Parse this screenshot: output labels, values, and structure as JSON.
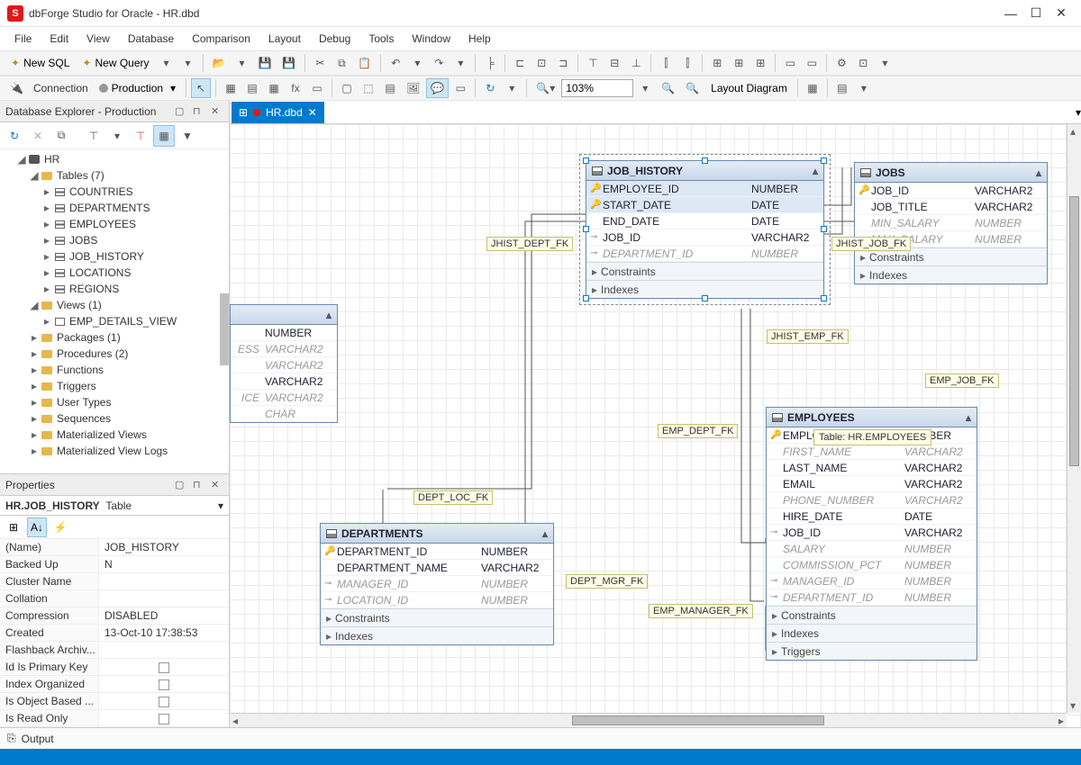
{
  "window": {
    "title": "dbForge Studio for Oracle - HR.dbd"
  },
  "menu": [
    "File",
    "Edit",
    "View",
    "Database",
    "Comparison",
    "Layout",
    "Debug",
    "Tools",
    "Window",
    "Help"
  ],
  "toolbar1": {
    "newsql": "New SQL",
    "newquery": "New Query"
  },
  "toolbar2": {
    "connection_label": "Connection",
    "connection_value": "Production",
    "zoom": "103%",
    "layout_btn": "Layout Diagram"
  },
  "tab": {
    "label": "HR.dbd"
  },
  "explorer": {
    "title": "Database Explorer - Production",
    "root": "HR",
    "tables_label": "Tables (7)",
    "tables": [
      "COUNTRIES",
      "DEPARTMENTS",
      "EMPLOYEES",
      "JOBS",
      "JOB_HISTORY",
      "LOCATIONS",
      "REGIONS"
    ],
    "views_label": "Views (1)",
    "views": [
      "EMP_DETAILS_VIEW"
    ],
    "folders": [
      "Packages (1)",
      "Procedures (2)",
      "Functions",
      "Triggers",
      "User Types",
      "Sequences",
      "Materialized Views",
      "Materialized View Logs"
    ]
  },
  "properties": {
    "title": "Properties",
    "subject": "HR.JOB_HISTORY",
    "subject_type": "Table",
    "rows": [
      {
        "name": "(Name)",
        "value": "JOB_HISTORY"
      },
      {
        "name": "Backed Up",
        "value": "N"
      },
      {
        "name": "Cluster Name",
        "value": ""
      },
      {
        "name": "Collation",
        "value": ""
      },
      {
        "name": "Compression",
        "value": "DISABLED"
      },
      {
        "name": "Created",
        "value": "13-Oct-10 17:38:53"
      },
      {
        "name": "Flashback Archiv...",
        "value": ""
      },
      {
        "name": "Id Is Primary Key",
        "value": "",
        "checkbox": true
      },
      {
        "name": "Index Organized",
        "value": "",
        "checkbox": true
      },
      {
        "name": "Is Object Based ...",
        "value": "",
        "checkbox": true
      },
      {
        "name": "Is Read Only",
        "value": "",
        "checkbox": true
      }
    ]
  },
  "entities": {
    "job_history": {
      "name": "JOB_HISTORY",
      "cols": [
        {
          "key": "pk",
          "name": "EMPLOYEE_ID",
          "type": "NUMBER"
        },
        {
          "key": "pk",
          "name": "START_DATE",
          "type": "DATE"
        },
        {
          "key": "",
          "name": "END_DATE",
          "type": "DATE"
        },
        {
          "key": "fk",
          "name": "JOB_ID",
          "type": "VARCHAR2"
        },
        {
          "key": "fk",
          "name": "DEPARTMENT_ID",
          "type": "NUMBER",
          "null": true
        }
      ],
      "sections": [
        "Constraints",
        "Indexes"
      ]
    },
    "jobs": {
      "name": "JOBS",
      "cols": [
        {
          "key": "pk",
          "name": "JOB_ID",
          "type": "VARCHAR2"
        },
        {
          "key": "",
          "name": "JOB_TITLE",
          "type": "VARCHAR2"
        },
        {
          "key": "",
          "name": "MIN_SALARY",
          "type": "NUMBER",
          "null": true
        },
        {
          "key": "",
          "name": "MAX_SALARY",
          "type": "NUMBER",
          "null": true
        }
      ],
      "sections": [
        "Constraints",
        "Indexes"
      ]
    },
    "departments": {
      "name": "DEPARTMENTS",
      "cols": [
        {
          "key": "pk",
          "name": "DEPARTMENT_ID",
          "type": "NUMBER"
        },
        {
          "key": "",
          "name": "DEPARTMENT_NAME",
          "type": "VARCHAR2"
        },
        {
          "key": "fk",
          "name": "MANAGER_ID",
          "type": "NUMBER",
          "null": true
        },
        {
          "key": "fk",
          "name": "LOCATION_ID",
          "type": "NUMBER",
          "null": true
        }
      ],
      "sections": [
        "Constraints",
        "Indexes"
      ]
    },
    "employees": {
      "name": "EMPLOYEES",
      "cols": [
        {
          "key": "pk",
          "name": "EMPLOYEE_ID",
          "type": "NUMBER"
        },
        {
          "key": "",
          "name": "FIRST_NAME",
          "type": "VARCHAR2",
          "null": true
        },
        {
          "key": "",
          "name": "LAST_NAME",
          "type": "VARCHAR2"
        },
        {
          "key": "",
          "name": "EMAIL",
          "type": "VARCHAR2"
        },
        {
          "key": "",
          "name": "PHONE_NUMBER",
          "type": "VARCHAR2",
          "null": true
        },
        {
          "key": "",
          "name": "HIRE_DATE",
          "type": "DATE"
        },
        {
          "key": "fk",
          "name": "JOB_ID",
          "type": "VARCHAR2"
        },
        {
          "key": "",
          "name": "SALARY",
          "type": "NUMBER",
          "null": true
        },
        {
          "key": "",
          "name": "COMMISSION_PCT",
          "type": "NUMBER",
          "null": true
        },
        {
          "key": "fk",
          "name": "MANAGER_ID",
          "type": "NUMBER",
          "null": true
        },
        {
          "key": "fk",
          "name": "DEPARTMENT_ID",
          "type": "NUMBER",
          "null": true
        }
      ],
      "sections": [
        "Constraints",
        "Indexes",
        "Triggers"
      ]
    },
    "partial": {
      "cols": [
        {
          "name": "",
          "type": "NUMBER"
        },
        {
          "name": "ESS",
          "type": "VARCHAR2",
          "null": true
        },
        {
          "name": "",
          "type": "VARCHAR2",
          "null": true
        },
        {
          "name": "",
          "type": "VARCHAR2"
        },
        {
          "name": "ICE",
          "type": "VARCHAR2",
          "null": true
        },
        {
          "name": "",
          "type": "CHAR",
          "null": true
        }
      ]
    }
  },
  "fk_labels": {
    "jhist_dept": "JHIST_DEPT_FK",
    "jhist_job": "JHIST_JOB_FK",
    "jhist_emp": "JHIST_EMP_FK",
    "emp_job": "EMP_JOB_FK",
    "emp_dept": "EMP_DEPT_FK",
    "dept_loc": "DEPT_LOC_FK",
    "dept_mgr": "DEPT_MGR_FK",
    "emp_mgr": "EMP_MANAGER_FK"
  },
  "tooltip": "Table: HR.EMPLOYEES",
  "output": "Output"
}
